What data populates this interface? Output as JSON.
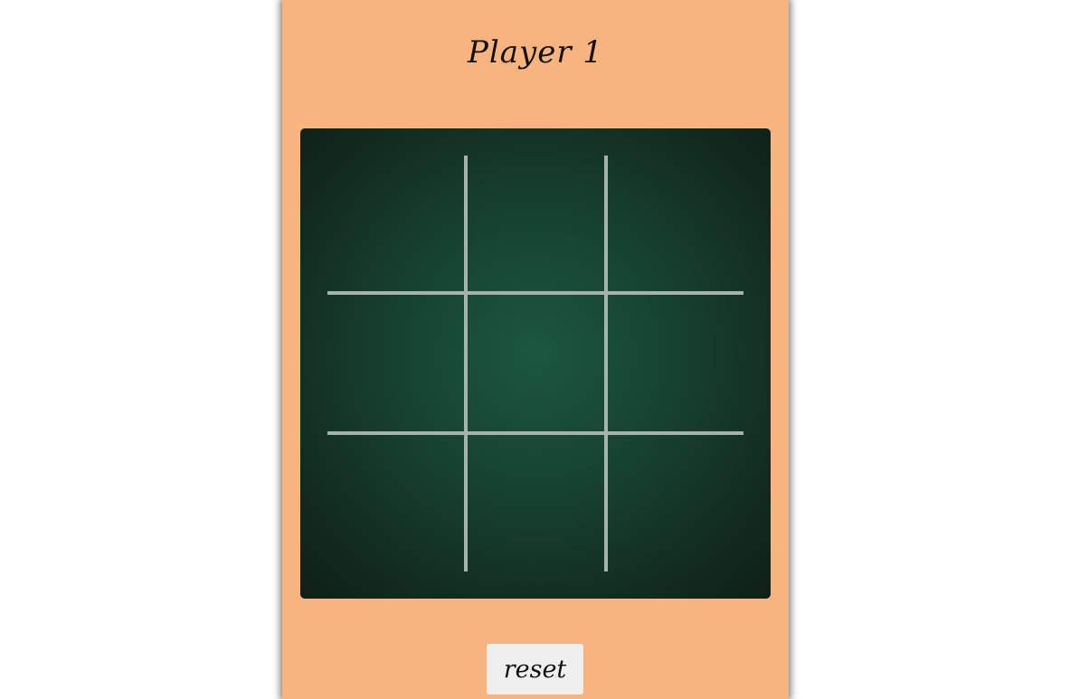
{
  "status": {
    "current_player": "Player 1"
  },
  "board": {
    "rows": 3,
    "cols": 3,
    "cells": [
      "",
      "",
      "",
      "",
      "",
      "",
      "",
      "",
      ""
    ]
  },
  "controls": {
    "reset_label": "reset"
  },
  "colors": {
    "panel_background": "#f8b47e",
    "board_center": "#1c5740",
    "board_edge": "#0f2019",
    "grid_lines": "#a7b2ad",
    "button_background": "#efefef"
  }
}
